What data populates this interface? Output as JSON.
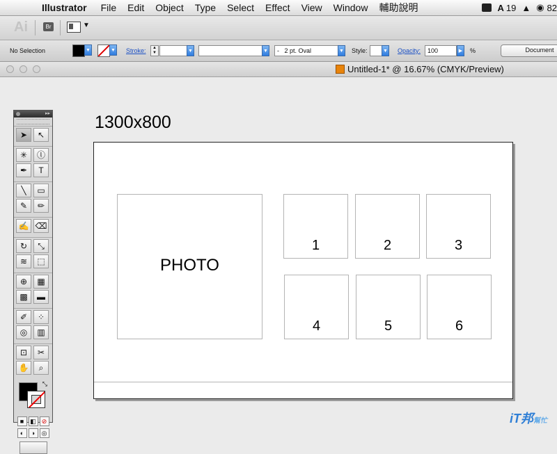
{
  "menubar": {
    "app_name": "Illustrator",
    "items": [
      "File",
      "Edit",
      "Object",
      "Type",
      "Select",
      "Effect",
      "View",
      "Window",
      "輔助說明"
    ],
    "status_adobe": "19",
    "status_cut": "82"
  },
  "appbar": {
    "logo": "Ai",
    "bridge": "Br"
  },
  "control": {
    "selection": "No Selection",
    "stroke_label": "Stroke:",
    "brush": "2 pt. Oval",
    "brush_prefix": "-",
    "style_label": "Style:",
    "opacity_label": "Opacity:",
    "opacity_value": "100",
    "percent": "%",
    "document_button": "Document"
  },
  "document": {
    "title": "Untitled-1* @ 16.67% (CMYK/Preview)"
  },
  "artboard": {
    "size_label": "1300x800",
    "photo_label": "PHOTO",
    "slots": [
      "1",
      "2",
      "3",
      "4",
      "5",
      "6"
    ]
  },
  "tools": [
    [
      "selection-tool",
      "➤"
    ],
    [
      "direct-selection-tool",
      "↖"
    ],
    [
      "magic-wand-tool",
      "✳"
    ],
    [
      "lasso-tool",
      "ⓛ"
    ],
    [
      "pen-tool",
      "✒"
    ],
    [
      "type-tool",
      "T"
    ],
    [
      "line-tool",
      "╲"
    ],
    [
      "rectangle-tool",
      "▭"
    ],
    [
      "paintbrush-tool",
      "✎"
    ],
    [
      "pencil-tool",
      "✏"
    ],
    [
      "blob-brush-tool",
      "✍"
    ],
    [
      "eraser-tool",
      "⌫"
    ],
    [
      "rotate-tool",
      "↻"
    ],
    [
      "scale-tool",
      "⤡"
    ],
    [
      "width-tool",
      "≋"
    ],
    [
      "free-transform-tool",
      "⬚"
    ],
    [
      "shape-builder-tool",
      "⊕"
    ],
    [
      "perspective-grid-tool",
      "▦"
    ],
    [
      "mesh-tool",
      "▩"
    ],
    [
      "gradient-tool",
      "▬"
    ],
    [
      "eyedropper-tool",
      "✐"
    ],
    [
      "blend-tool",
      "⁘"
    ],
    [
      "symbol-sprayer-tool",
      "◎"
    ],
    [
      "column-graph-tool",
      "▥"
    ],
    [
      "artboard-tool",
      "⊡"
    ],
    [
      "slice-tool",
      "✂"
    ],
    [
      "hand-tool",
      "✋"
    ],
    [
      "zoom-tool",
      "⌕"
    ]
  ],
  "watermark": {
    "main": "iT邦",
    "sub": "幫忙"
  }
}
